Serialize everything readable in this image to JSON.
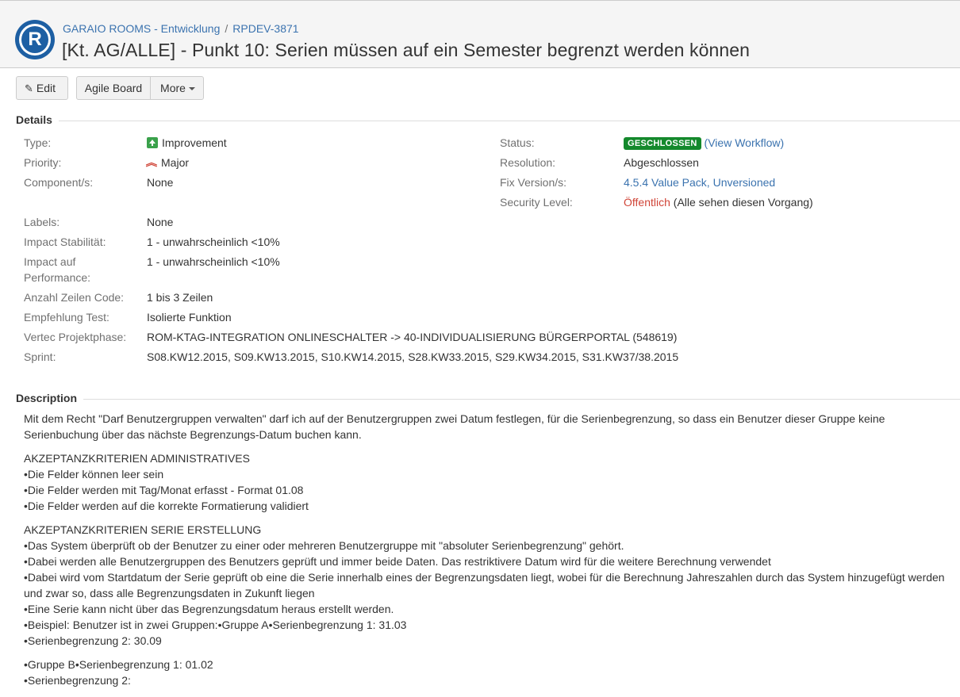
{
  "header": {
    "breadcrumb": [
      "GARAIO ROOMS - Entwicklung",
      "RPDEV-3871"
    ],
    "breadcrumb_sep": "/",
    "title": "[Kt. AG/ALLE] - Punkt 10: Serien müssen auf ein Semester begrenzt werden können",
    "logo_letter": "R"
  },
  "toolbar": {
    "edit": "Edit",
    "agile": "Agile Board",
    "more": "More"
  },
  "details": {
    "heading": "Details",
    "left": [
      {
        "label": "Type:",
        "value": "Improvement",
        "icon": "improvement-icon"
      },
      {
        "label": "Priority:",
        "value": "Major",
        "icon": "major-priority-icon"
      },
      {
        "label": "Component/s:",
        "value": "None"
      },
      {
        "label": "Labels:",
        "value": "None"
      },
      {
        "label": "Impact Stabilität:",
        "value": "1 - unwahrscheinlich <10%"
      },
      {
        "label": "Impact auf",
        "label2": "Performance:",
        "value": "1 - unwahrscheinlich <10%"
      },
      {
        "label": "Anzahl Zeilen Code:",
        "value": "1 bis 3 Zeilen"
      },
      {
        "label": "Empfehlung Test:",
        "value": "Isolierte Funktion"
      },
      {
        "label": "Vertec Projektphase:",
        "value": "ROM-KTAG-INTEGRATION ONLINESCHALTER -> 40-INDIVIDUALISIERUNG BÜRGERPORTAL (548619)"
      },
      {
        "label": "Sprint:",
        "value": "S08.KW12.2015, S09.KW13.2015, S10.KW14.2015, S28.KW33.2015, S29.KW34.2015, S31.KW37/38.2015"
      }
    ],
    "right": {
      "status_label": "Status:",
      "status_badge": "GESCHLOSSEN",
      "view_workflow": "View Workflow",
      "resolution_label": "Resolution:",
      "resolution_value": "Abgeschlossen",
      "fix_label": "Fix Version/s:",
      "fix_value": "4.5.4 Value Pack, Unversioned",
      "security_label": "Security Level:",
      "security_value": "Öffentlich",
      "security_note": "(Alle sehen diesen Vorgang)"
    }
  },
  "description": {
    "heading": "Description",
    "intro": "Mit dem Recht \"Darf Benutzergruppen verwalten\" darf ich auf der Benutzergruppen zwei Datum festlegen, für die Serienbegrenzung, so dass ein Benutzer dieser Gruppe keine Serienbuchung über das nächste Begrenzungs-Datum buchen kann.",
    "block1": [
      "AKZEPTANZKRITERIEN ADMINISTRATIVES",
      "•Die Felder können leer sein",
      "•Die Felder werden mit Tag/Monat erfasst - Format 01.08",
      "•Die Felder werden auf die korrekte Formatierung validiert"
    ],
    "block2": [
      "AKZEPTANZKRITERIEN SERIE ERSTELLUNG",
      "•Das System überprüft ob der Benutzer zu einer oder mehreren Benutzergruppe mit \"absoluter Serienbegrenzung\" gehört.",
      "•Dabei werden alle Benutzergruppen des Benutzers geprüft und immer beide Daten. Das restriktivere Datum wird für die weitere Berechnung verwendet",
      "•Dabei wird vom Startdatum der Serie geprüft ob eine die Serie innerhalb eines der Begrenzungsdaten liegt, wobei für die Berechnung Jahreszahlen durch das System hinzugefügt werden und zwar so, dass alle Begrenzungsdaten in Zukunft liegen",
      "•Eine Serie kann nicht über das Begrenzungsdatum heraus erstellt werden.",
      "•Beispiel: Benutzer ist in zwei Gruppen:•Gruppe A•Serienbegrenzung 1: 31.03",
      "•Serienbegrenzung 2: 30.09"
    ],
    "block3": [
      "•Gruppe B•Serienbegrenzung 1: 01.02",
      "•Serienbegrenzung 2:"
    ]
  }
}
